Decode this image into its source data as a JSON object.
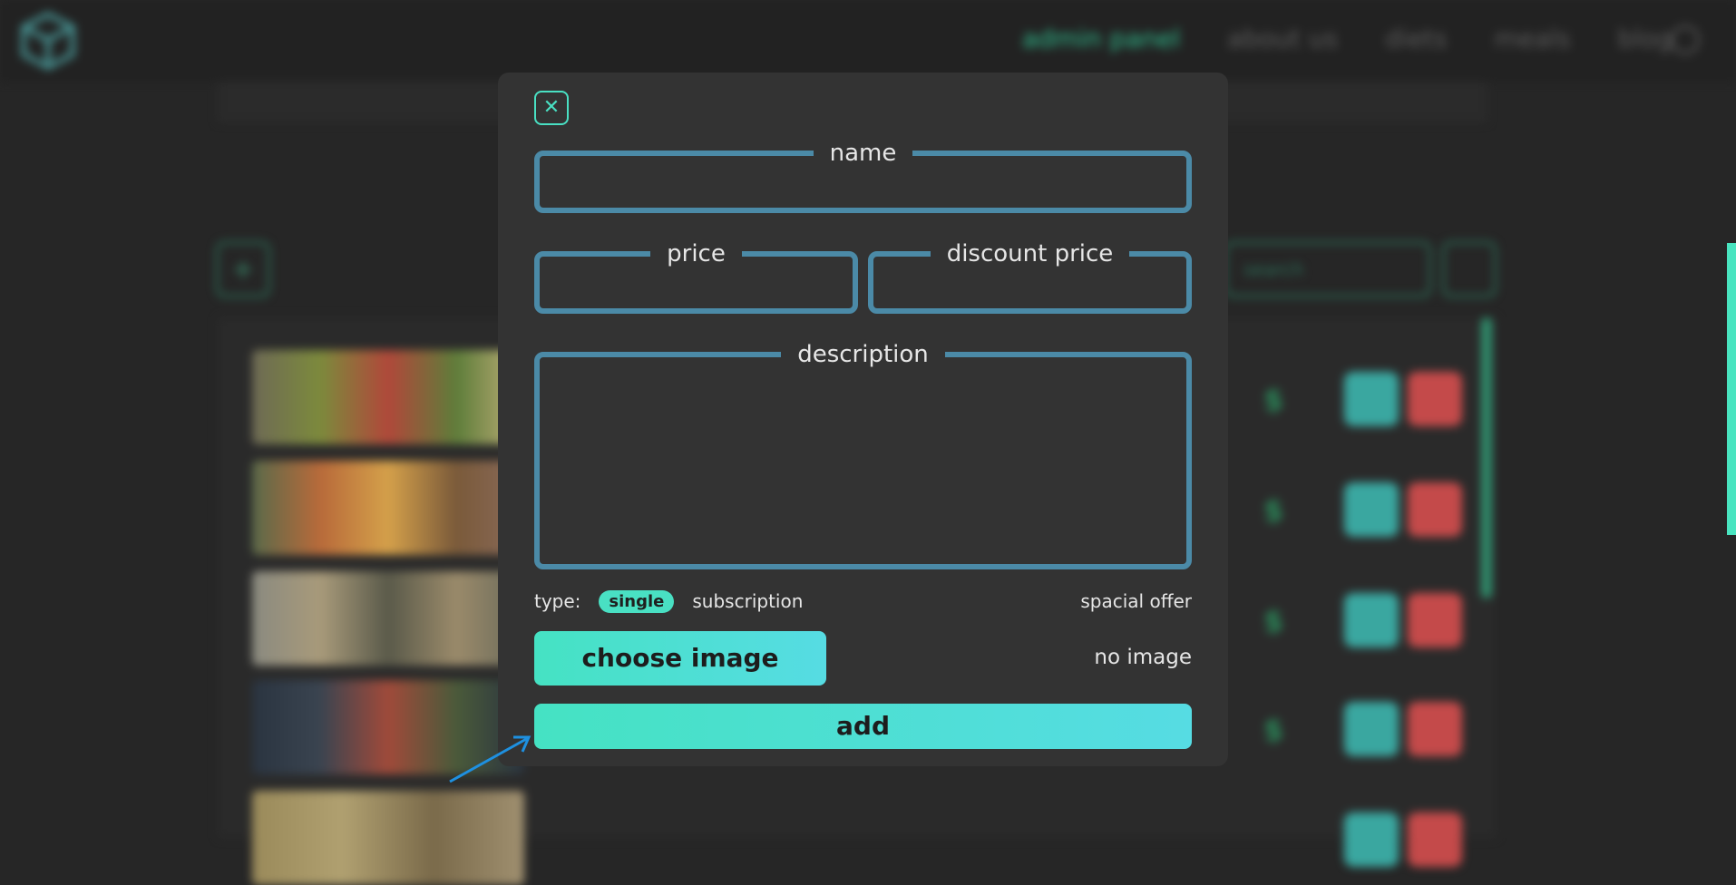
{
  "background": {
    "nav": [
      "admin panel",
      "about us",
      "diets",
      "meals",
      "blog"
    ],
    "add_icon": "plus-icon",
    "search_placeholder": "search",
    "prices": [
      "$",
      "$",
      "$",
      "$"
    ]
  },
  "modal": {
    "close_icon": "close-icon",
    "name_label": "name",
    "price_label": "price",
    "discount_label": "discount price",
    "description_label": "description",
    "type_label": "type:",
    "type_options": [
      "single",
      "subscription"
    ],
    "selected_type": "single",
    "special_offer": "spacial offer",
    "choose_image": "choose image",
    "image_status": "no image",
    "add_button": "add"
  },
  "colors": {
    "accent": "#49e0c3",
    "field_border": "#4b8aa7",
    "modal_bg": "#333333",
    "delete": "#c44a4a"
  }
}
